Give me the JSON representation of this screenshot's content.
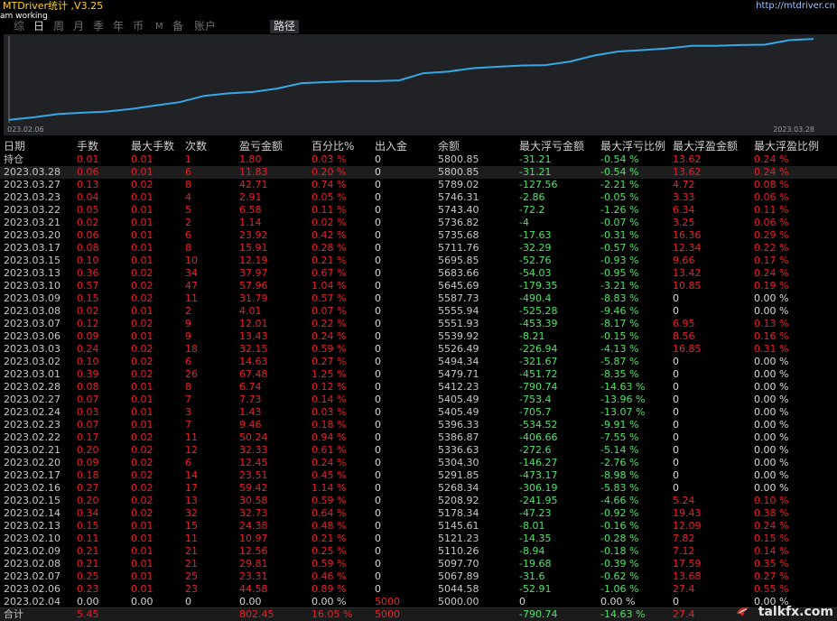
{
  "app": {
    "title": "MTDriver统计 ,V3.25",
    "url": "http://mtdriver.cn",
    "status": "am working"
  },
  "tabs": [
    {
      "label": "综",
      "active": false
    },
    {
      "label": "日",
      "active": true
    },
    {
      "label": "周",
      "active": false
    },
    {
      "label": "月",
      "active": false
    },
    {
      "label": "季",
      "active": false
    },
    {
      "label": "年",
      "active": false
    },
    {
      "label": "币",
      "active": false
    },
    {
      "label": "M",
      "active": false
    },
    {
      "label": "备",
      "active": false
    },
    {
      "label": "账户",
      "active": false
    },
    {
      "label": "路径",
      "active": true
    }
  ],
  "chart_data": {
    "type": "line",
    "x_start_label": "023.02.06",
    "x_end_label": "2023.03.28",
    "line_color": "#35a9e8",
    "x": [
      "2023.02.04",
      "2023.02.06",
      "2023.02.07",
      "2023.02.08",
      "2023.02.09",
      "2023.02.10",
      "2023.02.13",
      "2023.02.14",
      "2023.02.15",
      "2023.02.16",
      "2023.02.17",
      "2023.02.20",
      "2023.02.21",
      "2023.02.22",
      "2023.02.23",
      "2023.02.24",
      "2023.02.27",
      "2023.02.28",
      "2023.03.01",
      "2023.03.02",
      "2023.03.03",
      "2023.03.06",
      "2023.03.07",
      "2023.03.08",
      "2023.03.09",
      "2023.03.10",
      "2023.03.13",
      "2023.03.15",
      "2023.03.17",
      "2023.03.20",
      "2023.03.21",
      "2023.03.22",
      "2023.03.23",
      "2023.03.27",
      "2023.03.28"
    ],
    "y": [
      5000.0,
      5044.58,
      5067.89,
      5097.7,
      5110.26,
      5121.23,
      5145.61,
      5178.34,
      5208.92,
      5268.34,
      5291.85,
      5304.3,
      5336.63,
      5386.87,
      5396.33,
      5405.49,
      5405.49,
      5412.23,
      5479.71,
      5494.34,
      5526.49,
      5539.92,
      5551.93,
      5555.94,
      5587.73,
      5645.69,
      5683.66,
      5695.85,
      5711.76,
      5735.68,
      5736.82,
      5743.4,
      5746.31,
      5789.02,
      5800.85
    ],
    "ylim": [
      5000,
      5810
    ]
  },
  "table": {
    "headers": [
      "日期",
      "手数",
      "最大手数",
      "次数",
      "盈亏金额",
      "百分比%",
      "出入金",
      "余额",
      "最大浮亏金额",
      "最大浮亏比例",
      "最大浮盈金额",
      "最大浮盈比例"
    ],
    "holding": {
      "date": "持仓",
      "lots": "0.01",
      "max_lots": "0.01",
      "count": "1",
      "pnl": "1.80",
      "pct": "0.03 %",
      "flow": "0",
      "balance": "5800.85",
      "max_dd": "-31.21",
      "max_dd_pct": "-0.54 %",
      "max_fp": "13.62",
      "max_fp_pct": "0.24 %"
    },
    "rows": [
      {
        "date": "2023.03.28",
        "lots": "0.06",
        "max_lots": "0.01",
        "count": "6",
        "pnl": "11.83",
        "pct": "0.20 %",
        "flow": "0",
        "balance": "5800.85",
        "max_dd": "-31.21",
        "max_dd_pct": "-0.54 %",
        "max_fp": "13.62",
        "max_fp_pct": "0.24 %"
      },
      {
        "date": "2023.03.27",
        "lots": "0.13",
        "max_lots": "0.02",
        "count": "8",
        "pnl": "42.71",
        "pct": "0.74 %",
        "flow": "0",
        "balance": "5789.02",
        "max_dd": "-127.56",
        "max_dd_pct": "-2.21 %",
        "max_fp": "4.72",
        "max_fp_pct": "0.08 %"
      },
      {
        "date": "2023.03.23",
        "lots": "0.04",
        "max_lots": "0.01",
        "count": "4",
        "pnl": "2.91",
        "pct": "0.05 %",
        "flow": "0",
        "balance": "5746.31",
        "max_dd": "-2.86",
        "max_dd_pct": "-0.05 %",
        "max_fp": "3.33",
        "max_fp_pct": "0.06 %"
      },
      {
        "date": "2023.03.22",
        "lots": "0.05",
        "max_lots": "0.01",
        "count": "5",
        "pnl": "6.58",
        "pct": "0.11 %",
        "flow": "0",
        "balance": "5743.40",
        "max_dd": "-72.2",
        "max_dd_pct": "-1.26 %",
        "max_fp": "6.34",
        "max_fp_pct": "0.11 %"
      },
      {
        "date": "2023.03.21",
        "lots": "0.02",
        "max_lots": "0.01",
        "count": "2",
        "pnl": "1.14",
        "pct": "0.02 %",
        "flow": "0",
        "balance": "5736.82",
        "max_dd": "-4",
        "max_dd_pct": "-0.07 %",
        "max_fp": "3.25",
        "max_fp_pct": "0.06 %"
      },
      {
        "date": "2023.03.20",
        "lots": "0.06",
        "max_lots": "0.01",
        "count": "6",
        "pnl": "23.92",
        "pct": "0.42 %",
        "flow": "0",
        "balance": "5735.68",
        "max_dd": "-17.63",
        "max_dd_pct": "-0.31 %",
        "max_fp": "16.36",
        "max_fp_pct": "0.29 %"
      },
      {
        "date": "2023.03.17",
        "lots": "0.08",
        "max_lots": "0.01",
        "count": "8",
        "pnl": "15.91",
        "pct": "0.28 %",
        "flow": "0",
        "balance": "5711.76",
        "max_dd": "-32.29",
        "max_dd_pct": "-0.57 %",
        "max_fp": "12.34",
        "max_fp_pct": "0.22 %"
      },
      {
        "date": "2023.03.15",
        "lots": "0.10",
        "max_lots": "0.01",
        "count": "10",
        "pnl": "12.19",
        "pct": "0.21 %",
        "flow": "0",
        "balance": "5695.85",
        "max_dd": "-52.76",
        "max_dd_pct": "-0.93 %",
        "max_fp": "9.66",
        "max_fp_pct": "0.17 %"
      },
      {
        "date": "2023.03.13",
        "lots": "0.36",
        "max_lots": "0.02",
        "count": "34",
        "pnl": "37.97",
        "pct": "0.67 %",
        "flow": "0",
        "balance": "5683.66",
        "max_dd": "-54.03",
        "max_dd_pct": "-0.95 %",
        "max_fp": "13.42",
        "max_fp_pct": "0.24 %"
      },
      {
        "date": "2023.03.10",
        "lots": "0.57",
        "max_lots": "0.02",
        "count": "47",
        "pnl": "57.96",
        "pct": "1.04 %",
        "flow": "0",
        "balance": "5645.69",
        "max_dd": "-179.35",
        "max_dd_pct": "-3.21 %",
        "max_fp": "10.85",
        "max_fp_pct": "0.19 %"
      },
      {
        "date": "2023.03.09",
        "lots": "0.15",
        "max_lots": "0.02",
        "count": "11",
        "pnl": "31.79",
        "pct": "0.57 %",
        "flow": "0",
        "balance": "5587.73",
        "max_dd": "-490.4",
        "max_dd_pct": "-8.83 %",
        "max_fp": "0",
        "max_fp_pct": "0.00 %"
      },
      {
        "date": "2023.03.08",
        "lots": "0.02",
        "max_lots": "0.01",
        "count": "2",
        "pnl": "4.01",
        "pct": "0.07 %",
        "flow": "0",
        "balance": "5555.94",
        "max_dd": "-525.28",
        "max_dd_pct": "-9.46 %",
        "max_fp": "0",
        "max_fp_pct": "0.00 %"
      },
      {
        "date": "2023.03.07",
        "lots": "0.12",
        "max_lots": "0.02",
        "count": "9",
        "pnl": "12.01",
        "pct": "0.22 %",
        "flow": "0",
        "balance": "5551.93",
        "max_dd": "-453.39",
        "max_dd_pct": "-8.17 %",
        "max_fp": "6.95",
        "max_fp_pct": "0.13 %"
      },
      {
        "date": "2023.03.06",
        "lots": "0.09",
        "max_lots": "0.01",
        "count": "9",
        "pnl": "13.43",
        "pct": "0.24 %",
        "flow": "0",
        "balance": "5539.92",
        "max_dd": "-8.21",
        "max_dd_pct": "-0.15 %",
        "max_fp": "8.56",
        "max_fp_pct": "0.16 %"
      },
      {
        "date": "2023.03.03",
        "lots": "0.24",
        "max_lots": "0.02",
        "count": "18",
        "pnl": "32.15",
        "pct": "0.59 %",
        "flow": "0",
        "balance": "5526.49",
        "max_dd": "-226.94",
        "max_dd_pct": "-4.13 %",
        "max_fp": "16.85",
        "max_fp_pct": "0.31 %"
      },
      {
        "date": "2023.03.02",
        "lots": "0.10",
        "max_lots": "0.02",
        "count": "6",
        "pnl": "14.63",
        "pct": "0.27 %",
        "flow": "0",
        "balance": "5494.34",
        "max_dd": "-321.67",
        "max_dd_pct": "-5.87 %",
        "max_fp": "0",
        "max_fp_pct": "0.00 %"
      },
      {
        "date": "2023.03.01",
        "lots": "0.39",
        "max_lots": "0.02",
        "count": "26",
        "pnl": "67.48",
        "pct": "1.25 %",
        "flow": "0",
        "balance": "5479.71",
        "max_dd": "-451.72",
        "max_dd_pct": "-8.35 %",
        "max_fp": "0",
        "max_fp_pct": "0.00 %"
      },
      {
        "date": "2023.02.28",
        "lots": "0.08",
        "max_lots": "0.01",
        "count": "8",
        "pnl": "6.74",
        "pct": "0.12 %",
        "flow": "0",
        "balance": "5412.23",
        "max_dd": "-790.74",
        "max_dd_pct": "-14.63 %",
        "max_fp": "0",
        "max_fp_pct": "0.00 %"
      },
      {
        "date": "2023.02.27",
        "lots": "0.07",
        "max_lots": "0.01",
        "count": "7",
        "pnl": "7.73",
        "pct": "0.14 %",
        "flow": "0",
        "balance": "5405.49",
        "max_dd": "-753.4",
        "max_dd_pct": "-13.96 %",
        "max_fp": "0",
        "max_fp_pct": "0.00 %"
      },
      {
        "date": "2023.02.24",
        "lots": "0.03",
        "max_lots": "0.01",
        "count": "3",
        "pnl": "1.43",
        "pct": "0.03 %",
        "flow": "0",
        "balance": "5405.49",
        "max_dd": "-705.7",
        "max_dd_pct": "-13.07 %",
        "max_fp": "0",
        "max_fp_pct": "0.00 %"
      },
      {
        "date": "2023.02.23",
        "lots": "0.07",
        "max_lots": "0.01",
        "count": "7",
        "pnl": "9.46",
        "pct": "0.18 %",
        "flow": "0",
        "balance": "5396.33",
        "max_dd": "-534.52",
        "max_dd_pct": "-9.91 %",
        "max_fp": "0",
        "max_fp_pct": "0.00 %"
      },
      {
        "date": "2023.02.22",
        "lots": "0.17",
        "max_lots": "0.02",
        "count": "11",
        "pnl": "50.24",
        "pct": "0.94 %",
        "flow": "0",
        "balance": "5386.87",
        "max_dd": "-406.66",
        "max_dd_pct": "-7.55 %",
        "max_fp": "0",
        "max_fp_pct": "0.00 %"
      },
      {
        "date": "2023.02.21",
        "lots": "0.20",
        "max_lots": "0.02",
        "count": "12",
        "pnl": "32.33",
        "pct": "0.61 %",
        "flow": "0",
        "balance": "5336.63",
        "max_dd": "-272.6",
        "max_dd_pct": "-5.14 %",
        "max_fp": "0",
        "max_fp_pct": "0.00 %"
      },
      {
        "date": "2023.02.20",
        "lots": "0.09",
        "max_lots": "0.02",
        "count": "6",
        "pnl": "12.45",
        "pct": "0.24 %",
        "flow": "0",
        "balance": "5304.30",
        "max_dd": "-146.27",
        "max_dd_pct": "-2.76 %",
        "max_fp": "0",
        "max_fp_pct": "0.00 %"
      },
      {
        "date": "2023.02.17",
        "lots": "0.18",
        "max_lots": "0.02",
        "count": "14",
        "pnl": "23.51",
        "pct": "0.45 %",
        "flow": "0",
        "balance": "5291.85",
        "max_dd": "-473.17",
        "max_dd_pct": "-8.98 %",
        "max_fp": "0",
        "max_fp_pct": "0.00 %"
      },
      {
        "date": "2023.02.16",
        "lots": "0.27",
        "max_lots": "0.02",
        "count": "17",
        "pnl": "59.42",
        "pct": "1.14 %",
        "flow": "0",
        "balance": "5268.34",
        "max_dd": "-306.19",
        "max_dd_pct": "-5.83 %",
        "max_fp": "0",
        "max_fp_pct": "0.00 %"
      },
      {
        "date": "2023.02.15",
        "lots": "0.20",
        "max_lots": "0.02",
        "count": "13",
        "pnl": "30.58",
        "pct": "0.59 %",
        "flow": "0",
        "balance": "5208.92",
        "max_dd": "-241.95",
        "max_dd_pct": "-4.66 %",
        "max_fp": "5.24",
        "max_fp_pct": "0.10 %"
      },
      {
        "date": "2023.02.14",
        "lots": "0.34",
        "max_lots": "0.02",
        "count": "32",
        "pnl": "32.73",
        "pct": "0.64 %",
        "flow": "0",
        "balance": "5178.34",
        "max_dd": "-47.23",
        "max_dd_pct": "-0.92 %",
        "max_fp": "19.43",
        "max_fp_pct": "0.38 %"
      },
      {
        "date": "2023.02.13",
        "lots": "0.15",
        "max_lots": "0.01",
        "count": "15",
        "pnl": "24.38",
        "pct": "0.48 %",
        "flow": "0",
        "balance": "5145.61",
        "max_dd": "-8.01",
        "max_dd_pct": "-0.16 %",
        "max_fp": "12.09",
        "max_fp_pct": "0.24 %"
      },
      {
        "date": "2023.02.10",
        "lots": "0.11",
        "max_lots": "0.01",
        "count": "11",
        "pnl": "10.97",
        "pct": "0.21 %",
        "flow": "0",
        "balance": "5121.23",
        "max_dd": "-14.35",
        "max_dd_pct": "-0.28 %",
        "max_fp": "7.82",
        "max_fp_pct": "0.15 %"
      },
      {
        "date": "2023.02.09",
        "lots": "0.21",
        "max_lots": "0.01",
        "count": "21",
        "pnl": "12.56",
        "pct": "0.25 %",
        "flow": "0",
        "balance": "5110.26",
        "max_dd": "-8.94",
        "max_dd_pct": "-0.18 %",
        "max_fp": "7.12",
        "max_fp_pct": "0.14 %"
      },
      {
        "date": "2023.02.08",
        "lots": "0.21",
        "max_lots": "0.01",
        "count": "21",
        "pnl": "29.81",
        "pct": "0.59 %",
        "flow": "0",
        "balance": "5097.70",
        "max_dd": "-19.68",
        "max_dd_pct": "-0.39 %",
        "max_fp": "17.59",
        "max_fp_pct": "0.35 %"
      },
      {
        "date": "2023.02.07",
        "lots": "0.25",
        "max_lots": "0.01",
        "count": "25",
        "pnl": "23.31",
        "pct": "0.46 %",
        "flow": "0",
        "balance": "5067.89",
        "max_dd": "-31.6",
        "max_dd_pct": "-0.62 %",
        "max_fp": "13.68",
        "max_fp_pct": "0.27 %"
      },
      {
        "date": "2023.02.06",
        "lots": "0.23",
        "max_lots": "0.01",
        "count": "23",
        "pnl": "44.58",
        "pct": "0.89 %",
        "flow": "0",
        "balance": "5044.58",
        "max_dd": "-52.91",
        "max_dd_pct": "-1.06 %",
        "max_fp": "27.4",
        "max_fp_pct": "0.55 %"
      },
      {
        "date": "2023.02.04",
        "lots": "0.00",
        "max_lots": "0.00",
        "count": "0",
        "pnl": "0.00",
        "pct": "0.00 %",
        "flow": "5000",
        "balance": "5000.00",
        "max_dd": "0",
        "max_dd_pct": "0.00 %",
        "max_fp": "0",
        "max_fp_pct": "0.00 %"
      }
    ],
    "summary": {
      "date": "合计",
      "lots": "5.45",
      "max_lots": "",
      "count": "",
      "pnl": "802.45",
      "pct": "16.05 %",
      "flow": "5000",
      "balance": "",
      "max_dd": "-790.74",
      "max_dd_pct": "-14.63 %",
      "max_fp": "27.4",
      "max_fp_pct": ""
    }
  },
  "colors": {
    "positive": "#e8212a",
    "negative": "#4ee36a",
    "neutral": "#d9d9d9",
    "title": "#ffd21a",
    "chart_line": "#35a9e8"
  },
  "watermark": {
    "text": "talkfx.com",
    "icon": "talkfx-logo-icon"
  }
}
